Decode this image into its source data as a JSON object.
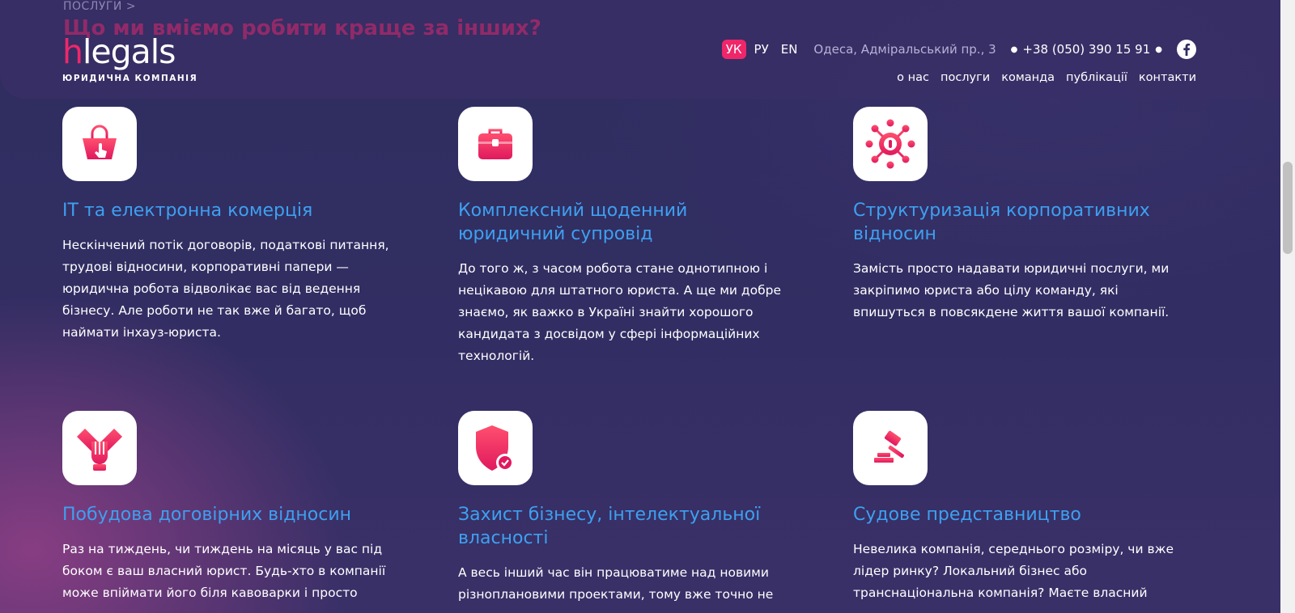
{
  "breadcrumb": "ПОСЛУГИ >",
  "ghost_heading": "Що ми вміємо робити краще за інших?",
  "logo": {
    "h": "h",
    "rest": "legals",
    "subtitle": "ЮРИДИЧНА КОМПАНІЯ"
  },
  "topbar": {
    "languages": [
      {
        "label": "УК",
        "active": true
      },
      {
        "label": "РУ",
        "active": false
      },
      {
        "label": "EN",
        "active": false
      }
    ],
    "address": "Одеса, Адміральський пр., 3",
    "phone": "+38 (050) 390 15 91",
    "social_icon": "facebook-icon"
  },
  "nav": [
    "о нас",
    "послуги",
    "команда",
    "публікації",
    "контакти"
  ],
  "colors": {
    "accent": "#f0266a",
    "title": "#3ea0f0",
    "background": "#2f2c5f"
  },
  "services": [
    {
      "icon": "shopping-basket-icon",
      "title": "IT та електронна комерція",
      "text": "Нескінчений потік договорів, податкові питання, трудові відносини, корпоративні папери — юридична робота відволікає вас від ведення бізнесу. Але роботи не так вже й багато, щоб наймати інхауз-юриста."
    },
    {
      "icon": "briefcase-icon",
      "title": "Комплексний щоденний юридичний супровід",
      "text": "До того ж, з часом робота стане однотипною і нецікавою для штатного юриста. А ще ми добре знаємо, як важко в Україні знайти хорошого кандидата з досвідом у сфері інформаційних технологій."
    },
    {
      "icon": "network-icon",
      "title": "Структуризація корпоративних відносин",
      "text": "Замість просто надавати юридичні послуги, ми закріпимо юриста або цілу команду, які впишуться в повсякдене життя вашої компанії."
    },
    {
      "icon": "handshake-icon",
      "title": "Побудова договірних відносин",
      "text": "Раз на тиждень, чи тиждень на місяць у вас під боком є ваш власний юрист. Будь-хто в компанії може впіймати його біля кавоварки і просто"
    },
    {
      "icon": "shield-check-icon",
      "title": "Захист бізнесу, інтелектуальної власності",
      "text": "А весь інший час він працюватиме над новими різноплановими проектами, тому вже точно не"
    },
    {
      "icon": "gavel-icon",
      "title": "Судове представництво",
      "text": "Невелика компанія, середнього розміру, чи вже лідер ринку? Локальний бізнес або транснаціональна компанія? Маєте власний"
    }
  ]
}
